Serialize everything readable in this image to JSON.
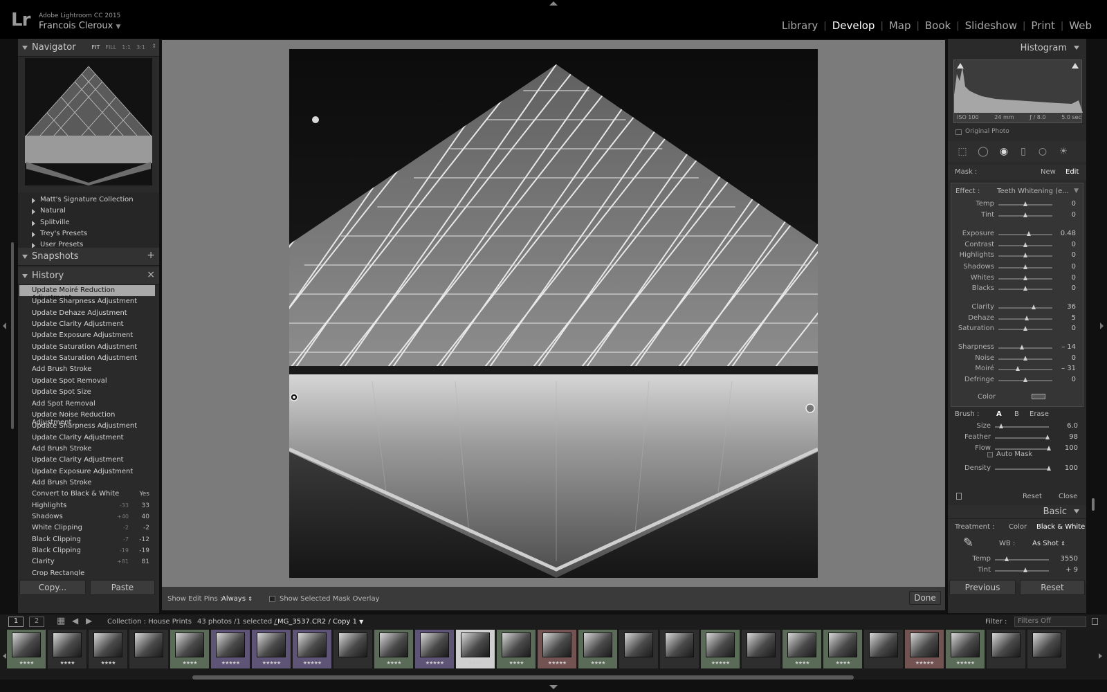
{
  "app": {
    "name": "Adobe Lightroom CC 2015",
    "user": "Francois Cleroux",
    "logo": "Lr"
  },
  "modules": [
    {
      "label": "Library"
    },
    {
      "label": "Develop",
      "active": true
    },
    {
      "label": "Map"
    },
    {
      "label": "Book"
    },
    {
      "label": "Slideshow"
    },
    {
      "label": "Print"
    },
    {
      "label": "Web"
    }
  ],
  "navigator": {
    "title": "Navigator",
    "zoom": [
      "FIT",
      "FILL",
      "1:1",
      "3:1"
    ]
  },
  "presets": [
    "Matt's Signature Collection",
    "Natural",
    "Splitville",
    "Trey's Presets",
    "User Presets"
  ],
  "snapshots": {
    "title": "Snapshots",
    "add_icon": "+"
  },
  "history": {
    "title": "History",
    "close_icon": "×",
    "items": [
      {
        "label": "Update Moiré Reduction Adjustment",
        "selected": true,
        "a": "",
        "b": ""
      },
      {
        "label": "Update Sharpness Adjustment",
        "a": "",
        "b": ""
      },
      {
        "label": "Update Dehaze Adjustment",
        "a": "",
        "b": ""
      },
      {
        "label": "Update Clarity Adjustment",
        "a": "",
        "b": ""
      },
      {
        "label": "Update Exposure Adjustment",
        "a": "",
        "b": ""
      },
      {
        "label": "Update Saturation Adjustment",
        "a": "",
        "b": ""
      },
      {
        "label": "Update Saturation Adjustment",
        "a": "",
        "b": ""
      },
      {
        "label": "Add Brush Stroke",
        "a": "",
        "b": ""
      },
      {
        "label": "Update Spot Removal",
        "a": "",
        "b": ""
      },
      {
        "label": "Update Spot Size",
        "a": "",
        "b": ""
      },
      {
        "label": "Add Spot Removal",
        "a": "",
        "b": ""
      },
      {
        "label": "Update Noise Reduction Adjustment",
        "a": "",
        "b": ""
      },
      {
        "label": "Update Sharpness Adjustment",
        "a": "",
        "b": ""
      },
      {
        "label": "Update Clarity Adjustment",
        "a": "",
        "b": ""
      },
      {
        "label": "Add Brush Stroke",
        "a": "",
        "b": ""
      },
      {
        "label": "Update Clarity Adjustment",
        "a": "",
        "b": ""
      },
      {
        "label": "Update Exposure Adjustment",
        "a": "",
        "b": ""
      },
      {
        "label": "Add Brush Stroke",
        "a": "",
        "b": ""
      },
      {
        "label": "Convert to Black & White",
        "a": "",
        "b": "Yes"
      },
      {
        "label": "Highlights",
        "a": "-33",
        "b": "33"
      },
      {
        "label": "Shadows",
        "a": "+40",
        "b": "40"
      },
      {
        "label": "White Clipping",
        "a": "-2",
        "b": "-2"
      },
      {
        "label": "Black Clipping",
        "a": "-7",
        "b": "-12"
      },
      {
        "label": "Black Clipping",
        "a": "-19",
        "b": "-19"
      },
      {
        "label": "Clarity",
        "a": "+81",
        "b": "81"
      },
      {
        "label": "Crop Rectangle",
        "a": "",
        "b": ""
      }
    ]
  },
  "left_buttons": {
    "copy": "Copy...",
    "paste": "Paste"
  },
  "toolbar": {
    "show_edit_pins_label": "Show Edit Pins :",
    "show_edit_pins_value": "Always",
    "mask_overlay_label": "Show Selected Mask Overlay",
    "done": "Done"
  },
  "histogram": {
    "title": "Histogram",
    "iso": "ISO 100",
    "focal": "24 mm",
    "aperture": "ƒ / 8.0",
    "shutter": "5.0 sec",
    "original_photo": "Original Photo"
  },
  "mask": {
    "label": "Mask :",
    "new": "New",
    "edit": "Edit"
  },
  "effect": {
    "label": "Effect :",
    "value": "Teeth Whitening (e...",
    "sliders": [
      {
        "label": "Temp",
        "value": "0",
        "pos": 0.5
      },
      {
        "label": "Tint",
        "value": "0",
        "pos": 0.5
      },
      {
        "label": "Exposure",
        "value": "0.48",
        "pos": 0.56
      },
      {
        "label": "Contrast",
        "value": "0",
        "pos": 0.5
      },
      {
        "label": "Highlights",
        "value": "0",
        "pos": 0.5
      },
      {
        "label": "Shadows",
        "value": "0",
        "pos": 0.5
      },
      {
        "label": "Whites",
        "value": "0",
        "pos": 0.5
      },
      {
        "label": "Blacks",
        "value": "0",
        "pos": 0.5
      },
      {
        "label": "Clarity",
        "value": "36",
        "pos": 0.66
      },
      {
        "label": "Dehaze",
        "value": "5",
        "pos": 0.52
      },
      {
        "label": "Saturation",
        "value": "0",
        "pos": 0.5
      },
      {
        "label": "Sharpness",
        "value": "– 14",
        "pos": 0.44
      },
      {
        "label": "Noise",
        "value": "0",
        "pos": 0.5
      },
      {
        "label": "Moiré",
        "value": "– 31",
        "pos": 0.36
      },
      {
        "label": "Defringe",
        "value": "0",
        "pos": 0.5
      }
    ],
    "color_label": "Color"
  },
  "brush": {
    "label": "Brush :",
    "a": "A",
    "b": "B",
    "erase": "Erase",
    "sliders": [
      {
        "label": "Size",
        "value": "6.0",
        "pos": 0.12
      },
      {
        "label": "Feather",
        "value": "98",
        "pos": 0.98
      },
      {
        "label": "Flow",
        "value": "100",
        "pos": 1.0
      },
      {
        "label": "Density",
        "value": "100",
        "pos": 1.0
      }
    ],
    "auto_mask": "Auto Mask",
    "reset": "Reset",
    "close": "Close"
  },
  "basic": {
    "title": "Basic",
    "treatment_label": "Treatment :",
    "color": "Color",
    "bw": "Black & White",
    "wb_label": "WB :",
    "wb_value": "As Shot",
    "sliders": [
      {
        "label": "Temp",
        "value": "3550",
        "pos": 0.22
      },
      {
        "label": "Tint",
        "value": "+ 9",
        "pos": 0.56
      }
    ]
  },
  "right_buttons": {
    "previous": "Previous",
    "reset": "Reset"
  },
  "filmstrip_bar": {
    "page1": "1",
    "page2": "2",
    "collection": "Collection : House Prints",
    "count": "43 photos /1 selected /",
    "file": "_MG_3537.CR2 / Copy 1",
    "filter_label": "Filter :",
    "filter_value": "Filters Off"
  },
  "filmstrip": [
    {
      "stars": "★★★★",
      "color": "#5a6b58"
    },
    {
      "stars": "★★★★",
      "color": "#2e2e2e"
    },
    {
      "stars": "★★★★",
      "color": "#2e2e2e"
    },
    {
      "stars": "",
      "color": "#2e2e2e"
    },
    {
      "stars": "★★★★",
      "color": "#5a6b58"
    },
    {
      "stars": "★★★★★",
      "color": "#5e5476"
    },
    {
      "stars": "★★★★★",
      "color": "#5e5476"
    },
    {
      "stars": "★★★★★",
      "color": "#5e5476"
    },
    {
      "stars": "",
      "color": "#2e2e2e"
    },
    {
      "stars": "★★★★",
      "color": "#5a6b58"
    },
    {
      "stars": "★★★★★",
      "color": "#5e5476"
    },
    {
      "stars": "★★★★",
      "color": "#cfcfcf"
    },
    {
      "stars": "★★★★",
      "color": "#5a6b58"
    },
    {
      "stars": "★★★★★",
      "color": "#735252"
    },
    {
      "stars": "★★★★",
      "color": "#5a6b58"
    },
    {
      "stars": "",
      "color": "#2e2e2e"
    },
    {
      "stars": "",
      "color": "#2e2e2e"
    },
    {
      "stars": "★★★★★",
      "color": "#5a6b58"
    },
    {
      "stars": "",
      "color": "#2e2e2e"
    },
    {
      "stars": "★★★★",
      "color": "#5a6b58"
    },
    {
      "stars": "★★★★",
      "color": "#5a6b58"
    },
    {
      "stars": "",
      "color": "#2e2e2e"
    },
    {
      "stars": "★★★★★",
      "color": "#735252"
    },
    {
      "stars": "★★★★★",
      "color": "#5a6b58"
    },
    {
      "stars": "",
      "color": "#2e2e2e"
    },
    {
      "stars": "",
      "color": "#2e2e2e"
    }
  ]
}
